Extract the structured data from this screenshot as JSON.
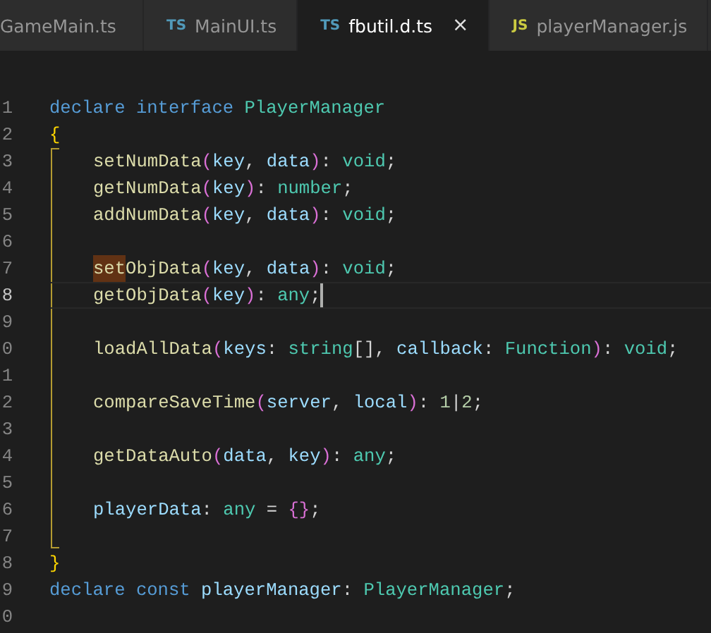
{
  "tabs": [
    {
      "label": "GameMain.ts",
      "selected": false
    },
    {
      "label": "MainUI.ts",
      "badge": "TS",
      "color": "#519aba",
      "selected": false
    },
    {
      "label": "fbutil.d.ts",
      "badge": "TS",
      "color": "#519aba",
      "selected": true,
      "close": "×"
    },
    {
      "label": "playerManager.js",
      "badge": "JS",
      "color": "#cbcb41",
      "selected": false
    }
  ],
  "lines": [
    {
      "number": "1",
      "current": false,
      "tokens": [
        {
          "kind": "keyword",
          "text": "declare "
        },
        {
          "kind": "keyword",
          "text": "interface "
        },
        {
          "kind": "type",
          "text": "PlayerManager"
        }
      ]
    },
    {
      "number": "2",
      "current": false,
      "tokens": [
        {
          "kind": "bracket1",
          "text": "{"
        }
      ]
    },
    {
      "number": "3",
      "current": false,
      "indented": true,
      "tokens": [
        {
          "kind": "function",
          "text": "setNumData"
        },
        {
          "kind": "bracket2",
          "text": "("
        },
        {
          "kind": "param",
          "text": "key"
        },
        {
          "kind": "plain",
          "text": ", "
        },
        {
          "kind": "param",
          "text": "data"
        },
        {
          "kind": "bracket2",
          "text": ")"
        },
        {
          "kind": "plain",
          "text": ": "
        },
        {
          "kind": "type",
          "text": "void"
        },
        {
          "kind": "plain",
          "text": ";"
        }
      ]
    },
    {
      "number": "4",
      "current": false,
      "indented": true,
      "tokens": [
        {
          "kind": "function",
          "text": "getNumData"
        },
        {
          "kind": "bracket2",
          "text": "("
        },
        {
          "kind": "param",
          "text": "key"
        },
        {
          "kind": "bracket2",
          "text": ")"
        },
        {
          "kind": "plain",
          "text": ": "
        },
        {
          "kind": "type",
          "text": "number"
        },
        {
          "kind": "plain",
          "text": ";"
        }
      ]
    },
    {
      "number": "5",
      "current": false,
      "indented": true,
      "tokens": [
        {
          "kind": "function",
          "text": "addNumData"
        },
        {
          "kind": "bracket2",
          "text": "("
        },
        {
          "kind": "param",
          "text": "key"
        },
        {
          "kind": "plain",
          "text": ", "
        },
        {
          "kind": "param",
          "text": "data"
        },
        {
          "kind": "bracket2",
          "text": ")"
        },
        {
          "kind": "plain",
          "text": ": "
        },
        {
          "kind": "type",
          "text": "void"
        },
        {
          "kind": "plain",
          "text": ";"
        }
      ]
    },
    {
      "number": "6",
      "current": false
    },
    {
      "number": "7",
      "current": false,
      "indented": true,
      "tokens": [
        {
          "kind": "function",
          "text": "set",
          "highlight": true
        },
        {
          "kind": "function",
          "text": "ObjData"
        },
        {
          "kind": "bracket2",
          "text": "("
        },
        {
          "kind": "param",
          "text": "key"
        },
        {
          "kind": "plain",
          "text": ", "
        },
        {
          "kind": "param",
          "text": "data"
        },
        {
          "kind": "bracket2",
          "text": ")"
        },
        {
          "kind": "plain",
          "text": ": "
        },
        {
          "kind": "type",
          "text": "void"
        },
        {
          "kind": "plain",
          "text": ";"
        }
      ]
    },
    {
      "number": "8",
      "current": true,
      "indented": true,
      "tokens": [
        {
          "kind": "function",
          "text": "getObjData"
        },
        {
          "kind": "bracket2",
          "text": "("
        },
        {
          "kind": "param",
          "text": "key"
        },
        {
          "kind": "bracket2",
          "text": ")"
        },
        {
          "kind": "plain",
          "text": ": "
        },
        {
          "kind": "type",
          "text": "any"
        },
        {
          "kind": "plain",
          "text": ";"
        }
      ]
    },
    {
      "number": "9",
      "current": false
    },
    {
      "number": "0",
      "current": false,
      "indented": true,
      "tokens": [
        {
          "kind": "function",
          "text": "loadAllData"
        },
        {
          "kind": "bracket2",
          "text": "("
        },
        {
          "kind": "param",
          "text": "keys"
        },
        {
          "kind": "plain",
          "text": ": "
        },
        {
          "kind": "type",
          "text": "string"
        },
        {
          "kind": "plain",
          "text": "[], "
        },
        {
          "kind": "param",
          "text": "callback"
        },
        {
          "kind": "plain",
          "text": ": "
        },
        {
          "kind": "type",
          "text": "Function"
        },
        {
          "kind": "bracket2",
          "text": ")"
        },
        {
          "kind": "plain",
          "text": ": "
        },
        {
          "kind": "type",
          "text": "void"
        },
        {
          "kind": "plain",
          "text": ";"
        }
      ]
    },
    {
      "number": "1",
      "current": false
    },
    {
      "number": "2",
      "current": false,
      "indented": true,
      "tokens": [
        {
          "kind": "function",
          "text": "compareSaveTime"
        },
        {
          "kind": "bracket2",
          "text": "("
        },
        {
          "kind": "param",
          "text": "server"
        },
        {
          "kind": "plain",
          "text": ", "
        },
        {
          "kind": "param",
          "text": "local"
        },
        {
          "kind": "bracket2",
          "text": ")"
        },
        {
          "kind": "plain",
          "text": ": "
        },
        {
          "kind": "number",
          "text": "1"
        },
        {
          "kind": "plain",
          "text": "|"
        },
        {
          "kind": "number",
          "text": "2"
        },
        {
          "kind": "plain",
          "text": ";"
        }
      ]
    },
    {
      "number": "3",
      "current": false
    },
    {
      "number": "4",
      "current": false,
      "indented": true,
      "tokens": [
        {
          "kind": "function",
          "text": "getDataAuto"
        },
        {
          "kind": "bracket2",
          "text": "("
        },
        {
          "kind": "param",
          "text": "data"
        },
        {
          "kind": "plain",
          "text": ", "
        },
        {
          "kind": "param",
          "text": "key"
        },
        {
          "kind": "bracket2",
          "text": ")"
        },
        {
          "kind": "plain",
          "text": ": "
        },
        {
          "kind": "type",
          "text": "any"
        },
        {
          "kind": "plain",
          "text": ";"
        }
      ]
    },
    {
      "number": "5",
      "current": false
    },
    {
      "number": "6",
      "current": false,
      "indented": true,
      "tokens": [
        {
          "kind": "param",
          "text": "playerData"
        },
        {
          "kind": "plain",
          "text": ": "
        },
        {
          "kind": "type",
          "text": "any"
        },
        {
          "kind": "plain",
          "text": " = "
        },
        {
          "kind": "bracket2",
          "text": "{}"
        },
        {
          "kind": "plain",
          "text": ";"
        }
      ]
    },
    {
      "number": "7",
      "current": false
    },
    {
      "number": "8",
      "current": false,
      "tokens": [
        {
          "kind": "bracket1",
          "text": "}"
        }
      ]
    },
    {
      "number": "9",
      "current": false,
      "tokens": [
        {
          "kind": "keyword",
          "text": "declare "
        },
        {
          "kind": "keyword",
          "text": "const "
        },
        {
          "kind": "param",
          "text": "playerManager"
        },
        {
          "kind": "plain",
          "text": ": "
        },
        {
          "kind": "type",
          "text": "PlayerManager"
        },
        {
          "kind": "plain",
          "text": ";"
        }
      ]
    },
    {
      "number": "0",
      "current": false
    }
  ]
}
